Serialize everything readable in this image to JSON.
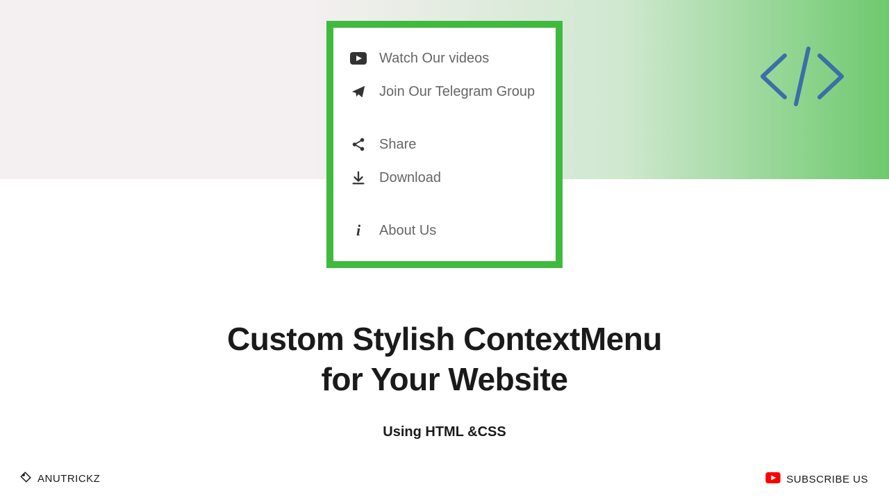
{
  "menu": {
    "items": [
      {
        "label": "Watch Our videos"
      },
      {
        "label": "Join Our Telegram Group"
      },
      {
        "label": "Share"
      },
      {
        "label": "Download"
      },
      {
        "label": "About Us"
      }
    ]
  },
  "title": {
    "line1": "Custom Stylish ContextMenu",
    "line2": "for Your Website"
  },
  "subtitle": "Using HTML &CSS",
  "footer": {
    "brand": "ANUTRICKZ",
    "cta": "SUBSCRIBE US"
  }
}
